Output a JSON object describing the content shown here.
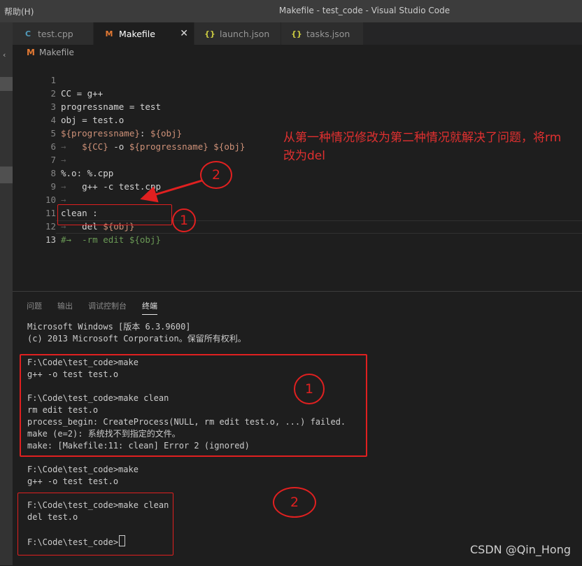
{
  "window": {
    "menu_help": "帮助(H)",
    "title": "Makefile - test_code - Visual Studio Code"
  },
  "tabs": [
    {
      "icon": "C",
      "label": "test.cpp"
    },
    {
      "icon": "M",
      "label": "Makefile"
    },
    {
      "icon": "{}",
      "label": "launch.json"
    },
    {
      "icon": "{}",
      "label": "tasks.json"
    }
  ],
  "breadcrumb": {
    "icon": "M",
    "label": "Makefile"
  },
  "editor": {
    "line_numbers": [
      "1",
      "2",
      "3",
      "4",
      "5",
      "6",
      "7",
      "8",
      "9",
      "10",
      "11",
      "12",
      "13"
    ],
    "lines": {
      "l1": "CC = g++",
      "l2": "progressname = test",
      "l3": "obj = test.o",
      "l4a": "${progressname}",
      "l4b": ": ",
      "l4c": "${obj}",
      "l5ws": "→   ",
      "l5a": "${CC}",
      "l5b": " -o ",
      "l5c": "${progressname}",
      "l5d": " ",
      "l5e": "${obj}",
      "l6ws": "→",
      "l7": "%.o: %.cpp",
      "l8ws": "→   ",
      "l8": "g++ -c test.cpp",
      "l9ws": "→",
      "l10": "clean :",
      "l11ws": "→   ",
      "l11a": "del ",
      "l11b": "${obj}",
      "l12": "#→  -rm edit ${obj}",
      "l13": ""
    }
  },
  "annotation": {
    "note": "从第一种情况修改为第二种情况就解决了问题，将rm改为del",
    "marker_one": "1",
    "marker_two": "2"
  },
  "panel": {
    "tabs": [
      "问题",
      "输出",
      "调试控制台",
      "终端"
    ],
    "active_tab": "终端",
    "terminal": {
      "header": "Microsoft Windows [版本 6.3.9600]\n(c) 2013 Microsoft Corporation。保留所有权利。",
      "block1": "F:\\Code\\test_code>make\ng++ -o test test.o\n\nF:\\Code\\test_code>make clean\nrm edit test.o\nprocess_begin: CreateProcess(NULL, rm edit test.o, ...) failed.\nmake (e=2): 系统找不到指定的文件。\nmake: [Makefile:11: clean] Error 2 (ignored)",
      "block2": "F:\\Code\\test_code>make\ng++ -o test test.o",
      "block3": "F:\\Code\\test_code>make clean\ndel test.o\n\nF:\\Code\\test_code>"
    }
  },
  "watermark": "CSDN @Qin_Hong",
  "colors": {
    "annotation": "#e02020",
    "variable": "#ce9178",
    "comment": "#6a9955",
    "makefile_icon": "#e37933",
    "cpp_icon": "#519aba",
    "json_icon": "#cbcb41"
  }
}
